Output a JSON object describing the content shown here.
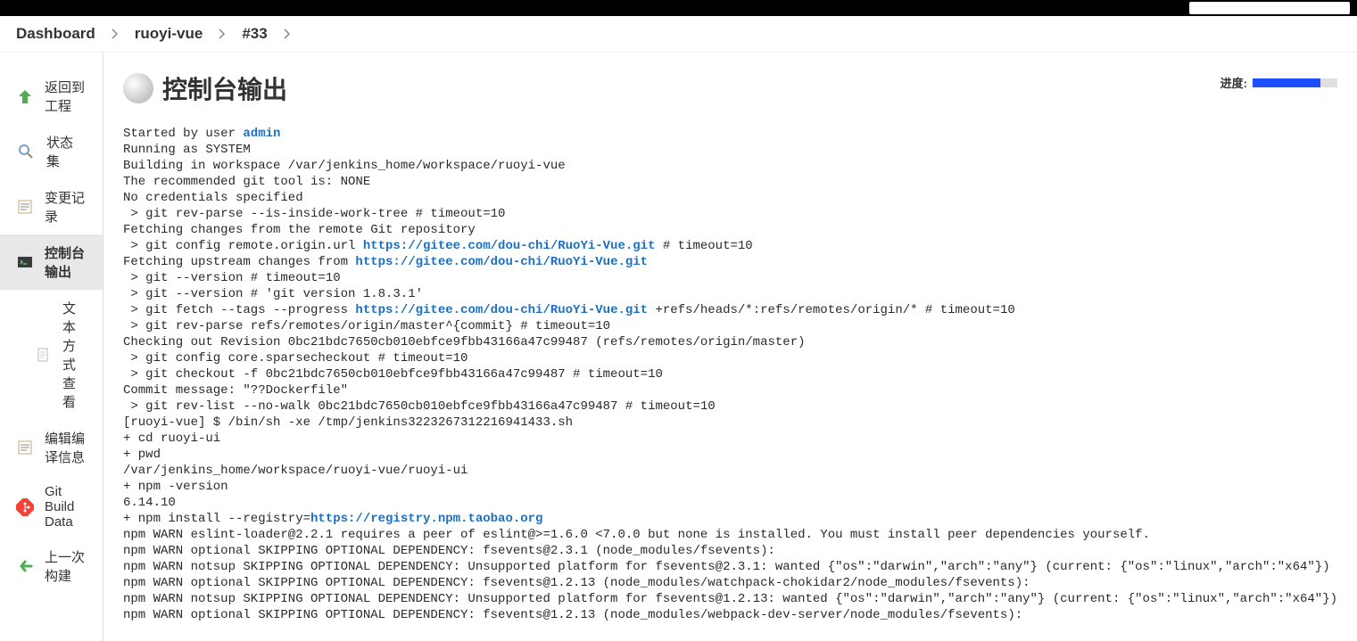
{
  "breadcrumbs": [
    "Dashboard",
    "ruoyi-vue",
    "#33"
  ],
  "sidebar": {
    "items": [
      {
        "label": "返回到工程"
      },
      {
        "label": "状态集"
      },
      {
        "label": "变更记录"
      },
      {
        "label": "控制台输出"
      },
      {
        "label": "文本方式查看"
      },
      {
        "label": "编辑编译信息"
      },
      {
        "label": "Git Build Data"
      },
      {
        "label": "上一次构建"
      }
    ]
  },
  "page": {
    "title": "控制台输出",
    "progress_label": "进度:"
  },
  "console": {
    "started_prefix": "Started by user ",
    "started_user": "admin",
    "line_running": "Running as SYSTEM",
    "line_building": "Building in workspace /var/jenkins_home/workspace/ruoyi-vue",
    "line_gittool": "The recommended git tool is: NONE",
    "line_nocreds": "No credentials specified",
    "line_revparse": " > git rev-parse --is-inside-work-tree # timeout=10",
    "line_fetching": "Fetching changes from the remote Git repository",
    "line_config_prefix": " > git config remote.origin.url ",
    "url_gitee": "https://gitee.com/dou-chi/RuoYi-Vue.git",
    "line_config_suffix": " # timeout=10",
    "line_fetchup_prefix": "Fetching upstream changes from ",
    "line_ver1": " > git --version # timeout=10",
    "line_ver2": " > git --version # 'git version 1.8.3.1'",
    "line_fetch_prefix": " > git fetch --tags --progress ",
    "line_fetch_suffix": " +refs/heads/*:refs/remotes/origin/* # timeout=10",
    "line_revparse2": " > git rev-parse refs/remotes/origin/master^{commit} # timeout=10",
    "line_checkout_rev": "Checking out Revision 0bc21bdc7650cb010ebfce9fbb43166a47c99487 (refs/remotes/origin/master)",
    "line_sparse": " > git config core.sparsecheckout # timeout=10",
    "line_checkout_f": " > git checkout -f 0bc21bdc7650cb010ebfce9fbb43166a47c99487 # timeout=10",
    "line_commitmsg": "Commit message: \"??Dockerfile\"",
    "line_revlist": " > git rev-list --no-walk 0bc21bdc7650cb010ebfce9fbb43166a47c99487 # timeout=10",
    "line_sh": "[ruoyi-vue] $ /bin/sh -xe /tmp/jenkins3223267312216941433.sh",
    "line_cd": "+ cd ruoyi-ui",
    "line_pwd": "+ pwd",
    "line_pwd_out": "/var/jenkins_home/workspace/ruoyi-vue/ruoyi-ui",
    "line_npmv": "+ npm -version",
    "line_npmv_out": "6.14.10",
    "line_npm_install_prefix": "+ npm install --registry=",
    "url_taobao": "https://registry.npm.taobao.org",
    "line_warn1": "npm WARN eslint-loader@2.2.1 requires a peer of eslint@>=1.6.0 <7.0.0 but none is installed. You must install peer dependencies yourself.",
    "line_warn2": "npm WARN optional SKIPPING OPTIONAL DEPENDENCY: fsevents@2.3.1 (node_modules/fsevents):",
    "line_warn3": "npm WARN notsup SKIPPING OPTIONAL DEPENDENCY: Unsupported platform for fsevents@2.3.1: wanted {\"os\":\"darwin\",\"arch\":\"any\"} (current: {\"os\":\"linux\",\"arch\":\"x64\"})",
    "line_warn4": "npm WARN optional SKIPPING OPTIONAL DEPENDENCY: fsevents@1.2.13 (node_modules/watchpack-chokidar2/node_modules/fsevents):",
    "line_warn5": "npm WARN notsup SKIPPING OPTIONAL DEPENDENCY: Unsupported platform for fsevents@1.2.13: wanted {\"os\":\"darwin\",\"arch\":\"any\"} (current: {\"os\":\"linux\",\"arch\":\"x64\"})",
    "line_warn6": "npm WARN optional SKIPPING OPTIONAL DEPENDENCY: fsevents@1.2.13 (node_modules/webpack-dev-server/node_modules/fsevents):"
  }
}
